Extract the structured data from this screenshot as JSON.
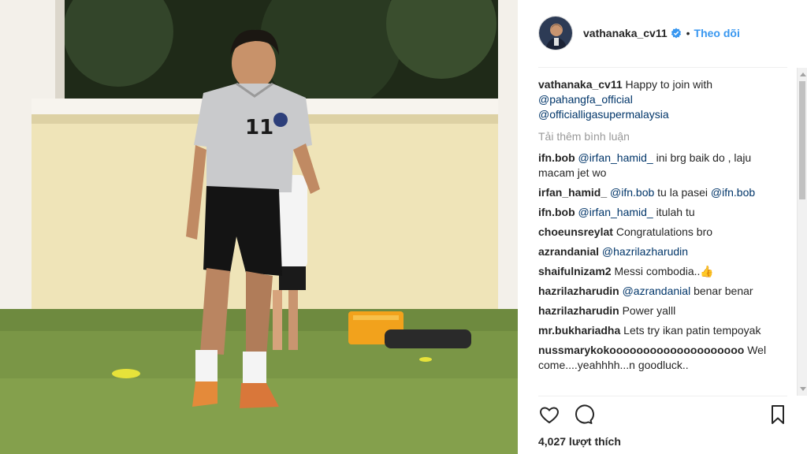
{
  "post": {
    "username": "vathanaka_cv11",
    "follow_label": "Theo dõi",
    "separator": "•",
    "caption": {
      "username": "vathanaka_cv11",
      "text": "Happy to join with",
      "mention1": "@pahangfa_official",
      "mention2": "@officialligasupermalaysia"
    },
    "load_more": "Tải thêm bình luận",
    "likes": "4,027 lượt thích",
    "jersey_number": "11"
  },
  "comments": [
    {
      "user": "ifn.bob",
      "mention": "@irfan_hamid_",
      "text": " ini brg baik do , laju macam jet wo",
      "mention2": "",
      "tail": ""
    },
    {
      "user": "irfan_hamid_",
      "mention": "@ifn.bob",
      "text": " tu la pasei ",
      "mention2": "@ifn.bob",
      "tail": ""
    },
    {
      "user": "ifn.bob",
      "mention": "@irfan_hamid_",
      "text": " itulah tu",
      "mention2": "",
      "tail": ""
    },
    {
      "user": "choeunsreylat",
      "mention": "",
      "text": "Congratulations bro",
      "mention2": "",
      "tail": ""
    },
    {
      "user": "azrandanial",
      "mention": "@hazrilazharudin",
      "text": "",
      "mention2": "",
      "tail": ""
    },
    {
      "user": "shaifulnizam2",
      "mention": "",
      "text": "Messi combodia..👍",
      "mention2": "",
      "tail": ""
    },
    {
      "user": "hazrilazharudin",
      "mention": "@azrandanial",
      "text": " benar benar",
      "mention2": "",
      "tail": ""
    },
    {
      "user": "hazrilazharudin",
      "mention": "",
      "text": "Power yalll",
      "mention2": "",
      "tail": ""
    },
    {
      "user": "mr.bukhariadha",
      "mention": "",
      "text": "Lets try ikan patin tempoyak",
      "mention2": "",
      "tail": ""
    },
    {
      "user": "nussmarykokoooooooooooooooooooo",
      "mention": "",
      "text": "Wel come....yeahhhh...n goodluck..",
      "mention2": "",
      "tail": ""
    }
  ],
  "icons": {
    "verified": "verified-badge-icon",
    "like": "heart-icon",
    "comment": "comment-bubble-icon",
    "save": "bookmark-icon"
  },
  "colors": {
    "link": "#3897f0",
    "mention": "#003569",
    "muted": "#999999",
    "text": "#262626"
  }
}
